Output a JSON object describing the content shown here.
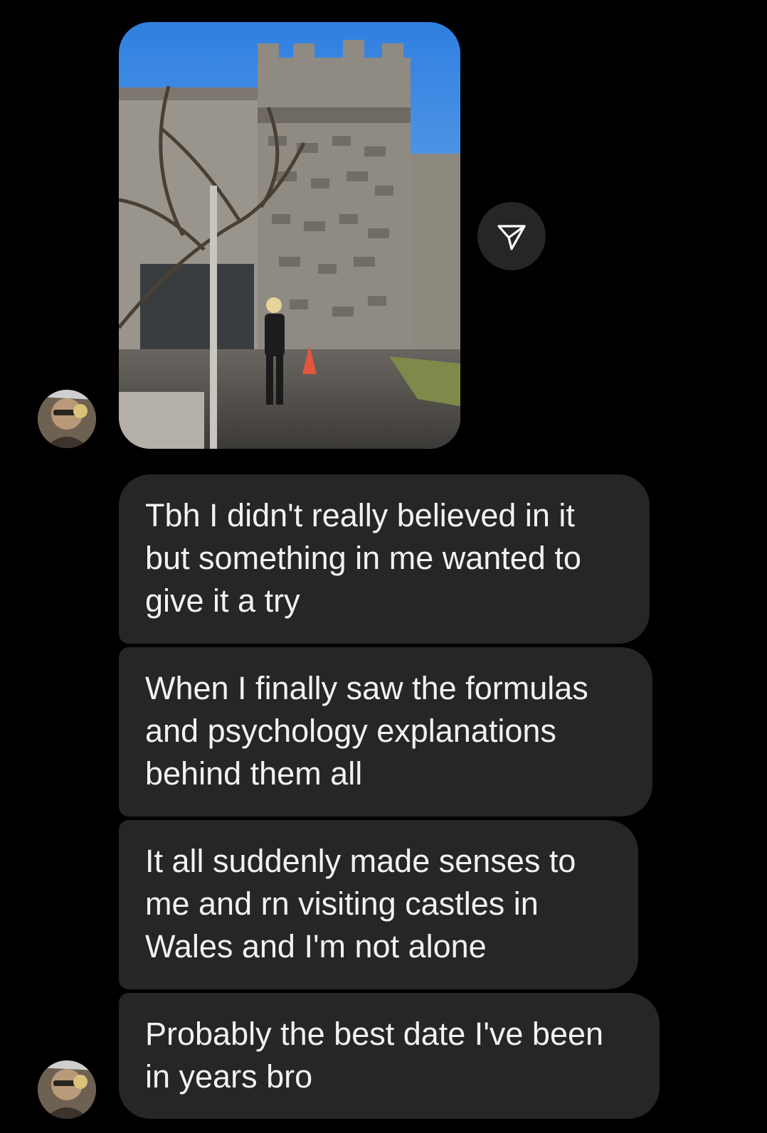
{
  "conversation": {
    "messages": [
      {
        "type": "image",
        "description_icon": "castle-photo"
      },
      {
        "type": "text",
        "text": "Tbh I didn't really believed in it\nbut something in me wanted to\ngive it a try"
      },
      {
        "type": "text",
        "text": "When I finally saw the formulas\nand psychology explanations\nbehind them all"
      },
      {
        "type": "text",
        "text": "It all suddenly made senses to\nme and rn visiting castles in\nWales and I'm not alone"
      },
      {
        "type": "text",
        "text": "Probably the best date I've been\nin years bro"
      }
    ]
  },
  "actions": {
    "share_icon": "paper-plane-icon"
  },
  "colors": {
    "background": "#000000",
    "bubble": "#262626",
    "text": "#f2f2f2",
    "share_button": "#262626"
  }
}
